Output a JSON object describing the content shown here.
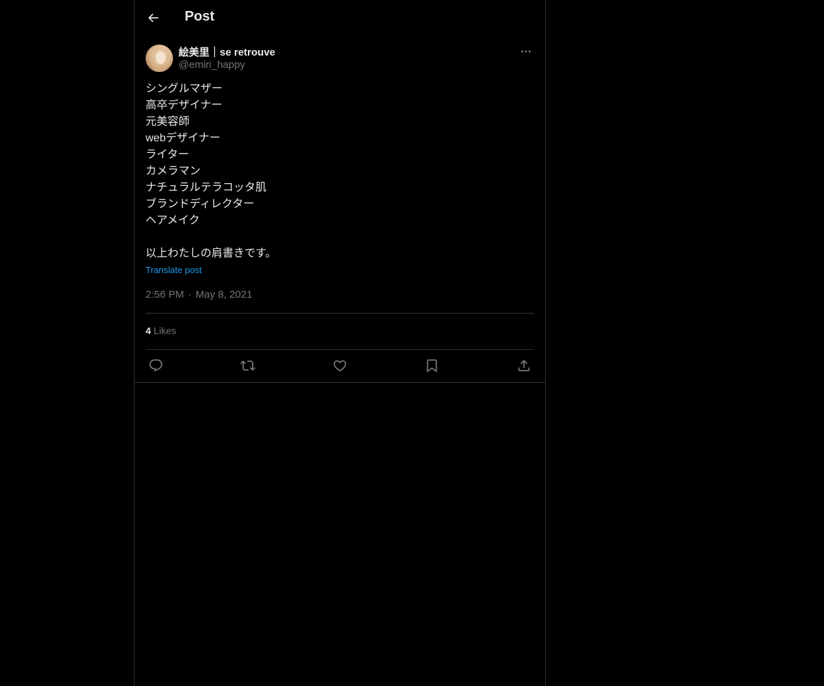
{
  "header": {
    "title": "Post"
  },
  "post": {
    "author": {
      "display_name": "絵美里｜se retrouve",
      "handle": "@emiri_happy"
    },
    "body_lines": [
      "シングルマザー",
      "高卒デザイナー",
      "元美容師",
      "webデザイナー",
      "ライター",
      "カメラマン",
      "ナチュラルテラコッタ肌",
      "ブランドディレクター",
      "ヘアメイク",
      "",
      "以上わたしの肩書きです。"
    ],
    "translate_label": "Translate post",
    "time": "2:56 PM",
    "separator": "·",
    "date": "May 8, 2021",
    "likes_count": "4",
    "likes_label": "Likes"
  },
  "colors": {
    "background": "#000000",
    "text": "#e7e9ea",
    "secondary": "#71767b",
    "border": "#2f3336",
    "accent": "#1d9bf0"
  },
  "icons": {
    "back": "arrow-left-icon",
    "more": "more-horizontal-icon",
    "reply": "reply-icon",
    "repost": "repost-icon",
    "like": "heart-icon",
    "bookmark": "bookmark-icon",
    "share": "share-icon"
  }
}
